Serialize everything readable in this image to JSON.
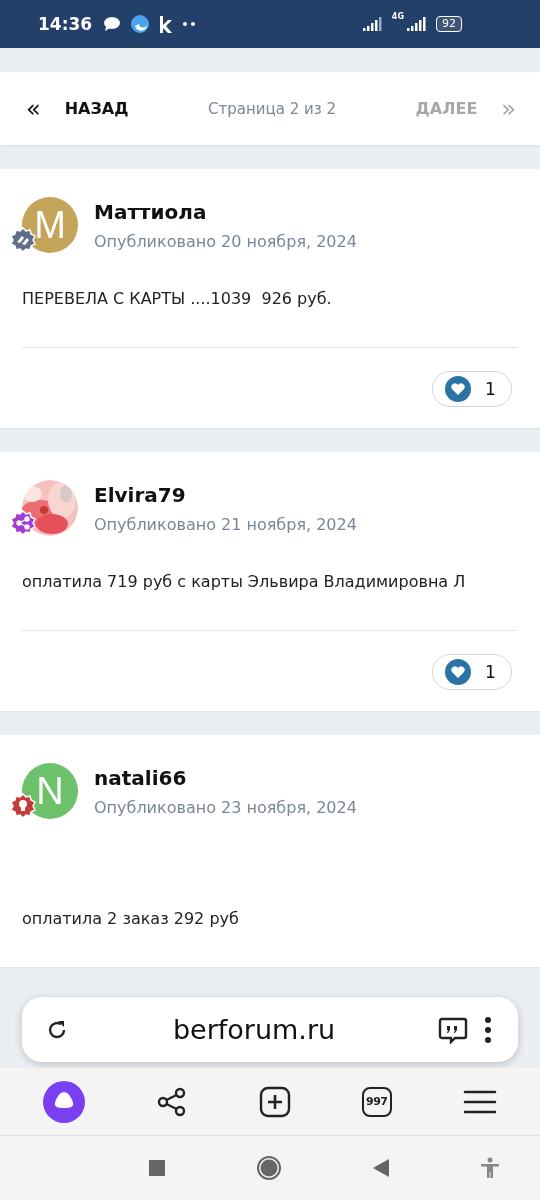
{
  "status_bar": {
    "time": "14:36",
    "battery": "92",
    "network": "4G"
  },
  "pagination": {
    "prev_arrow": "«",
    "next_arrow": "»",
    "prev": "НАЗАД",
    "page": "Страница 2 из 2",
    "next": "ДАЛЕЕ",
    "next_disabled": true
  },
  "posts": [
    {
      "author": "Маттиола",
      "avatar": {
        "kind": "letter",
        "letter": "M",
        "color": "#c4a458"
      },
      "badge": {
        "kind": "hands",
        "color": "#5f6f8a"
      },
      "date": "Опубликовано 20 ноября, 2024",
      "body": "ПЕРЕВЕЛА С КАРТЫ ....1039  926 руб.",
      "reactions": "1"
    },
    {
      "author": "Elvira79",
      "badge": {
        "kind": "share",
        "color": "#a43ccf"
      },
      "date": "Опубликовано 21 ноября, 2024",
      "body": "оплатила 719 руб с карты Эльвира Владимировна Л",
      "reactions": "1"
    },
    {
      "author": "natali66",
      "avatar": {
        "kind": "letter",
        "letter": "N",
        "color": "#6cc16a"
      },
      "badge": {
        "kind": "bulb",
        "color": "#c73a3a"
      },
      "date": "Опубликовано 23 ноября, 2024",
      "body": "оплатила 2 заказ 292 руб"
    }
  ],
  "browser": {
    "url": "berforum.ru",
    "tabs_count": "997"
  }
}
